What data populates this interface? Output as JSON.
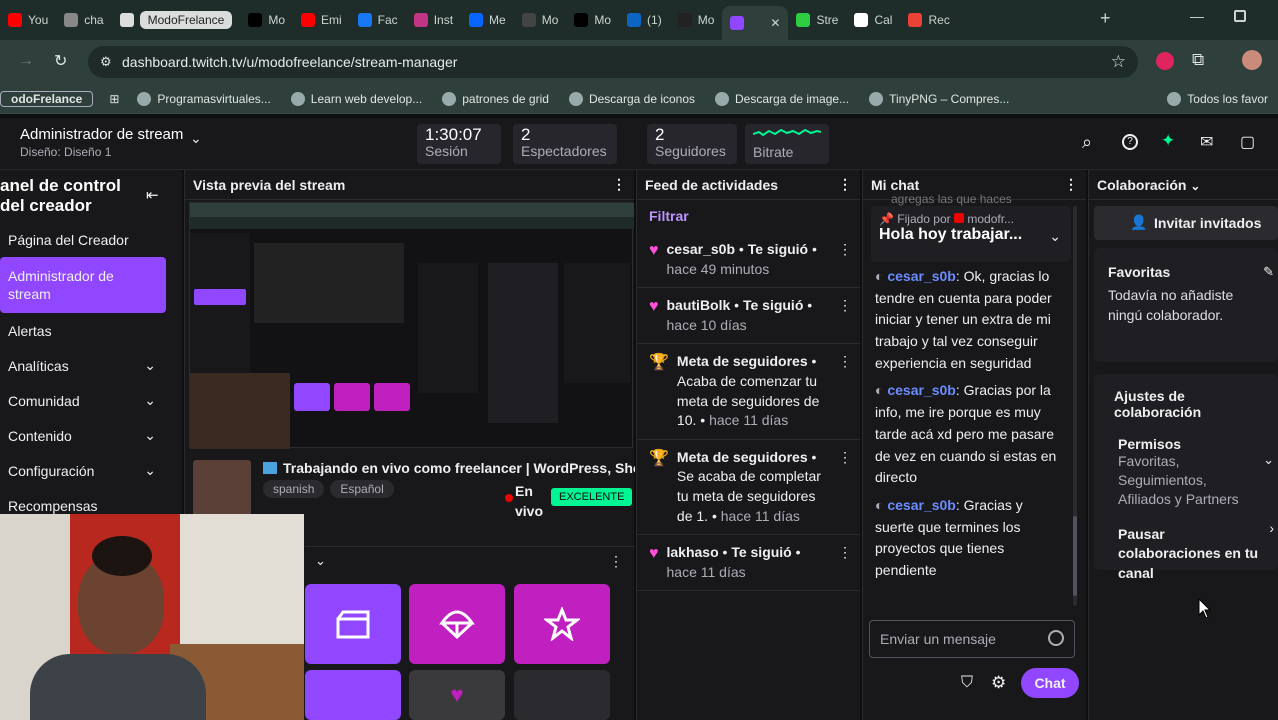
{
  "browser": {
    "tabs": [
      {
        "label": "You",
        "color": "#ff0000"
      },
      {
        "label": "cha",
        "color": "#888888"
      },
      {
        "label": "ModoFrelance",
        "color": "#dddddd",
        "pill": true
      },
      {
        "label": "Mo",
        "color": "#000000"
      },
      {
        "label": "Emi",
        "color": "#ff0000"
      },
      {
        "label": "Fac",
        "color": "#1877f2"
      },
      {
        "label": "Inst",
        "color": "#c13584"
      },
      {
        "label": "Me",
        "color": "#0866ff"
      },
      {
        "label": "Mo",
        "color": "#444444"
      },
      {
        "label": "Mo",
        "color": "#000000"
      },
      {
        "label": "(1)",
        "color": "#0a66c2"
      },
      {
        "label": "Mo",
        "color": "#222222"
      },
      {
        "label": "",
        "color": "#9147ff",
        "active": true
      },
      {
        "label": "Stre",
        "color": "#2ecc40"
      },
      {
        "label": "Cal",
        "color": "#ffffff"
      },
      {
        "label": "Rec",
        "color": "#ea4335"
      }
    ],
    "url": "dashboard.twitch.tv/u/modofreelance/stream-manager",
    "bookmarks": [
      {
        "label": "odoFrelance",
        "boxed": true
      },
      {
        "label": "Programasvirtuales..."
      },
      {
        "label": "Learn web develop..."
      },
      {
        "label": "patrones de grid"
      },
      {
        "label": "Descarga de iconos"
      },
      {
        "label": "Descarga de image..."
      },
      {
        "label": "TinyPNG – Compres..."
      },
      {
        "label": "Todos los favor"
      }
    ]
  },
  "header": {
    "title": "Administrador de stream",
    "subtitle": "Diseño: Diseño 1",
    "stats": [
      {
        "value": "1:30:07",
        "label": "Sesión"
      },
      {
        "value": "2",
        "label": "Espectadores"
      },
      {
        "value": "2",
        "label": "Seguidores"
      },
      {
        "value": "",
        "label": "Bitrate"
      }
    ]
  },
  "sidebar": {
    "title": "anel de control del creador",
    "items": [
      {
        "label": "Página del Creador",
        "chevron": false
      },
      {
        "label": "Administrador de stream",
        "chevron": false,
        "active": true
      },
      {
        "label": "Alertas",
        "chevron": false
      },
      {
        "label": "Analíticas",
        "chevron": true
      },
      {
        "label": "Comunidad",
        "chevron": true
      },
      {
        "label": "Contenido",
        "chevron": true
      },
      {
        "label": "Configuración",
        "chevron": true
      },
      {
        "label": "Recompensas",
        "chevron": false
      }
    ]
  },
  "preview": {
    "header": "Vista previa del stream",
    "stream_title": "Trabajando en vivo como freelancer | WordPress, Sho",
    "tags": [
      "spanish",
      "Español"
    ],
    "live_label": "En vivo",
    "quality_badge": "EXCELENTE"
  },
  "feed": {
    "header": "Feed de actividades",
    "filter": "Filtrar",
    "items": [
      {
        "icon": "heart",
        "user": "cesar_s0b",
        "action": "Te siguió",
        "time": "hace 49 minutos"
      },
      {
        "icon": "heart",
        "user": "bautiBolk",
        "action": "Te siguió",
        "time": "hace 10 días"
      },
      {
        "icon": "trophy",
        "user": "Meta de seguidores",
        "action": "Acaba de comenzar tu meta de seguidores de 10.",
        "time": "hace 11 días"
      },
      {
        "icon": "trophy",
        "user": "Meta de seguidores",
        "action": "Se acaba de completar tu meta de seguidores de 1.",
        "time": "hace 11 días"
      },
      {
        "icon": "heart",
        "user": "lakhaso",
        "action": "Te siguió",
        "time": "hace 11 días"
      }
    ]
  },
  "chat": {
    "header": "Mi chat",
    "partial_line": "agregas las que haces",
    "pinned_by": "Fijado por",
    "pinned_user": "modofr...",
    "pinned_text": "Hola hoy trabajar...",
    "messages": [
      {
        "user": "cesar_s0b",
        "text": "Ok, gracias lo tendre en cuenta para poder iniciar y tener un extra de mi trabajo y tal vez conseguir experiencia en seguridad"
      },
      {
        "user": "cesar_s0b",
        "text": "Gracias por la info, me ire porque es muy tarde acá xd pero me pasare de vez en cuando si estas en directo"
      },
      {
        "user": "cesar_s0b",
        "text": "Gracias y suerte que termines los proyectos que tienes pendiente"
      }
    ],
    "input_placeholder": "Enviar un mensaje",
    "send_label": "Chat"
  },
  "collab": {
    "header": "Colaboración",
    "invite": "Invitar invitados",
    "favorites_title": "Favoritas",
    "favorites_text": "Todavía no añadiste ningú colaborador.",
    "settings_title": "Ajustes de colaboración",
    "permissions_title": "Permisos",
    "permissions_text": "Favoritas, Seguimientos, Afiliados y Partners",
    "pause_text": "Pausar colaboraciones en tu canal"
  }
}
